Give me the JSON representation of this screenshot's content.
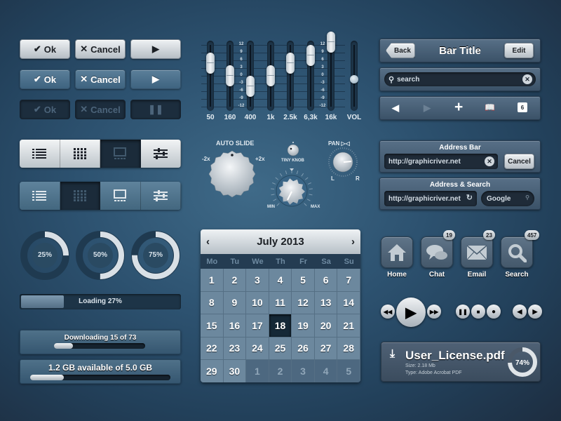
{
  "buttons": {
    "row_light": {
      "ok": "Ok",
      "cancel": "Cancel",
      "play": "play"
    },
    "row_mid": {
      "ok": "Ok",
      "cancel": "Cancel",
      "play": "play"
    },
    "row_disabled": {
      "ok": "Ok",
      "cancel": "Cancel",
      "pause": "pause"
    }
  },
  "segmented": {
    "light": {
      "items": [
        "list-view",
        "grid-view",
        "slideshow-view",
        "settings-sliders"
      ],
      "selected": 2
    },
    "mid": {
      "items": [
        "list-view",
        "grid-view",
        "slideshow-view",
        "settings-sliders"
      ],
      "selected": 1
    }
  },
  "equalizer": {
    "scale": [
      "12",
      "9",
      "6",
      "3",
      "0",
      "-3",
      "-6",
      "-9",
      "-12"
    ],
    "bands": [
      {
        "label": "50",
        "value": 5
      },
      {
        "label": "160",
        "value": 0
      },
      {
        "label": "400",
        "value": -4
      },
      {
        "label": "1k",
        "value": 0
      },
      {
        "label": "2.5k",
        "value": 5
      },
      {
        "label": "6,3k",
        "value": 8
      },
      {
        "label": "16k",
        "value": 13
      }
    ],
    "volume": {
      "label": "VOL",
      "value": 0.45
    }
  },
  "knobs": {
    "auto_slide": {
      "title": "AUTO SLIDE",
      "min_label": "-2x",
      "max_label": "+2x"
    },
    "tiny": {
      "title": "TINY KNOB"
    },
    "pan": {
      "title": "PAN",
      "left": "L",
      "right": "R"
    },
    "volume_knob": {
      "min": "MIN",
      "max": "MAX"
    }
  },
  "rings": [
    {
      "value": 25,
      "label": "25%"
    },
    {
      "value": 50,
      "label": "50%"
    },
    {
      "value": 75,
      "label": "75%"
    }
  ],
  "loading": {
    "label": "Loading 27%",
    "value": 27
  },
  "downloading": {
    "label": "Downloading 15 of 73",
    "current": 15,
    "total": 73
  },
  "storage": {
    "label": "1.2 GB available of 5.0 GB",
    "used": 1.2,
    "total": 5.0
  },
  "navbar": {
    "back": "Back",
    "title": "Bar Title",
    "edit": "Edit"
  },
  "searchbar": {
    "placeholder": "search"
  },
  "toolbar": {
    "tabs_count": "6"
  },
  "address_bar": {
    "title": "Address Bar",
    "url": "http://graphicriver.net",
    "cancel": "Cancel"
  },
  "address_search": {
    "title": "Address & Search",
    "url": "http://graphicriver.net",
    "search_placeholder": "Google"
  },
  "calendar": {
    "month": "July 2013",
    "weekdays": [
      "Mo",
      "Tu",
      "We",
      "Th",
      "Fr",
      "Sa",
      "Su"
    ],
    "days": [
      "1",
      "2",
      "3",
      "4",
      "5",
      "6",
      "7",
      "8",
      "9",
      "10",
      "11",
      "12",
      "13",
      "14",
      "15",
      "16",
      "17",
      "18",
      "19",
      "20",
      "21",
      "22",
      "23",
      "24",
      "25",
      "26",
      "27",
      "28",
      "29",
      "30",
      "1",
      "2",
      "3",
      "4",
      "5"
    ],
    "selected": "18",
    "days_in_month": 30
  },
  "apps": [
    {
      "label": "Home",
      "icon": "home-icon",
      "badge": ""
    },
    {
      "label": "Chat",
      "icon": "chat-icon",
      "badge": "19"
    },
    {
      "label": "Email",
      "icon": "email-icon",
      "badge": "23"
    },
    {
      "label": "Search",
      "icon": "search-icon",
      "badge": "457"
    }
  ],
  "file": {
    "name": "User_License.pdf",
    "size": "Size: 2.18 Mb",
    "type": "Type: Adobe Acrobat PDF",
    "progress": 74,
    "progress_label": "74%"
  }
}
